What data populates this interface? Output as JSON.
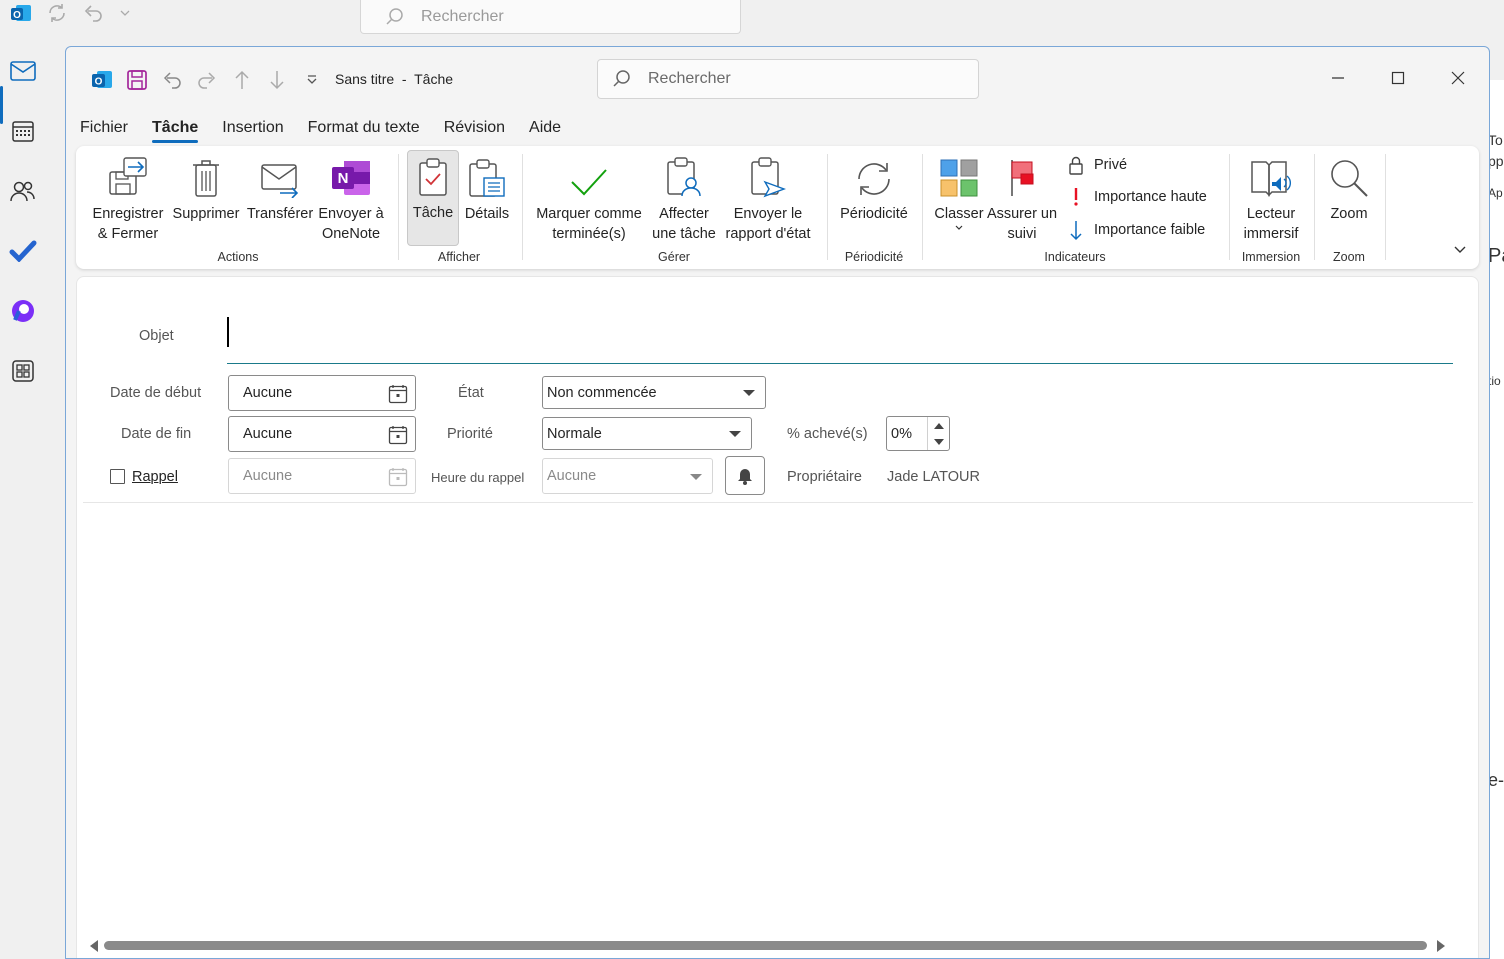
{
  "background": {
    "search_placeholder": "Rechercher",
    "right_edge_texts": [
      "To",
      "pp",
      "Ap",
      "Pa",
      "tio",
      "e-"
    ]
  },
  "window": {
    "title": "Sans titre  -  Tâche",
    "search_placeholder": "Rechercher"
  },
  "menu": {
    "items": [
      "Fichier",
      "Tâche",
      "Insertion",
      "Format du texte",
      "Révision",
      "Aide"
    ],
    "active": "Tâche"
  },
  "ribbon": {
    "save_close": "Enregistrer\n& Fermer",
    "delete": "Supprimer",
    "forward": "Transférer",
    "onenote": "Envoyer à\nOneNote",
    "task": "Tâche",
    "details": "Détails",
    "mark_complete": "Marquer comme\nterminée(s)",
    "assign": "Affecter\nune tâche",
    "send_status": "Envoyer le\nrapport d'état",
    "recurrence": "Périodicité",
    "categorize": "Classer",
    "follow_up": "Assurer un\nsuivi",
    "private": "Privé",
    "high_importance": "Importance haute",
    "low_importance": "Importance faible",
    "immersive_reader": "Lecteur\nimmersif",
    "zoom": "Zoom",
    "groups": {
      "actions": "Actions",
      "show": "Afficher",
      "manage": "Gérer",
      "recurrence": "Périodicité",
      "tags": "Indicateurs",
      "immersive": "Immersion",
      "zoom": "Zoom"
    }
  },
  "form": {
    "subject_label": "Objet",
    "subject_value": "",
    "start_label": "Date de début",
    "start_value": "Aucune",
    "due_label": "Date de fin",
    "due_value": "Aucune",
    "reminder_label": "Rappel",
    "reminder_checked": false,
    "reminder_date": "Aucune",
    "status_label": "État",
    "status_value": "Non commencée",
    "priority_label": "Priorité",
    "priority_value": "Normale",
    "reminder_time_label": "Heure du rappel",
    "reminder_time_value": "Aucune",
    "percent_label": "% achevé(s)",
    "percent_value": "0%",
    "owner_label": "Propriétaire",
    "owner_value": "Jade LATOUR"
  },
  "colors": {
    "accent": "#0f6cbd",
    "onenote": "#7719aa",
    "flag_red": "#e81123",
    "check_green": "#13a10e"
  }
}
